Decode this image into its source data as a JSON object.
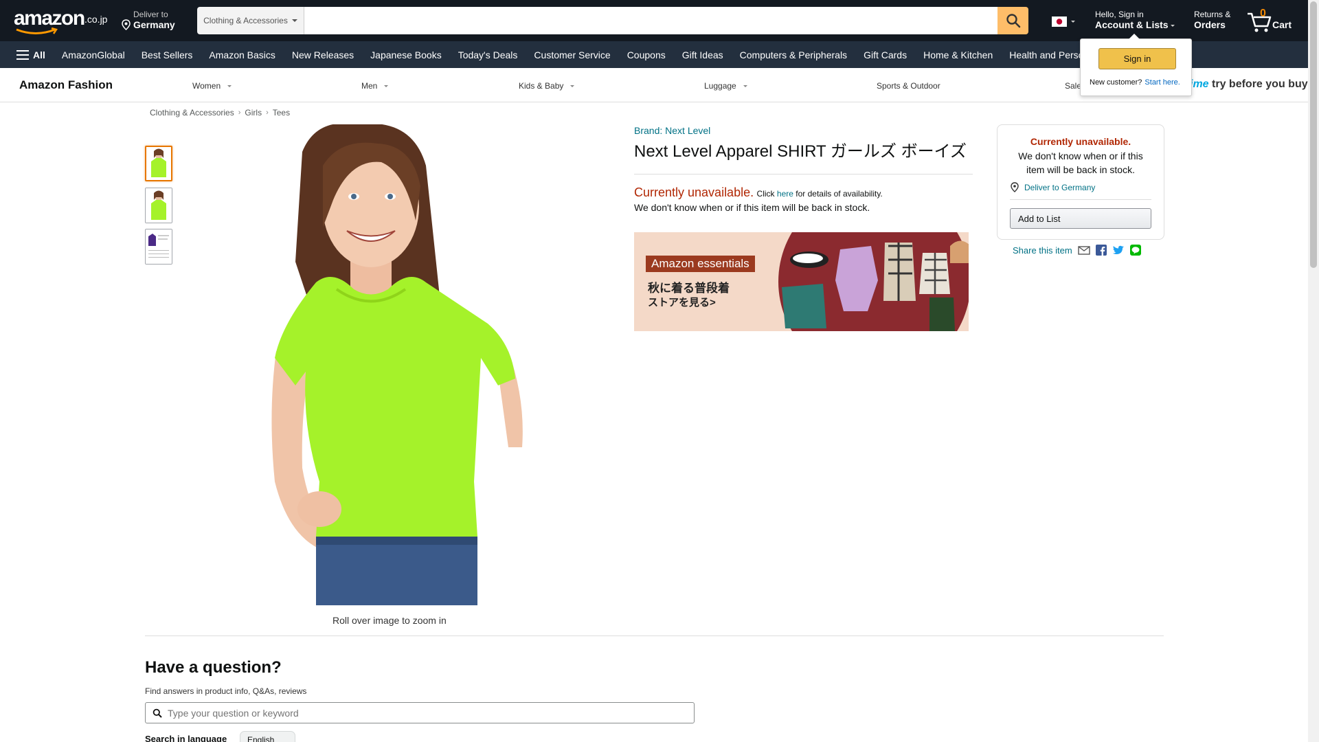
{
  "header": {
    "logo_text": "amazon",
    "logo_suffix": ".co.jp",
    "deliver_line1": "Deliver to",
    "deliver_line2": "Germany",
    "search_category": "Clothing & Accessories",
    "search_placeholder": "",
    "account_line1": "Hello, Sign in",
    "account_line2": "Account & Lists",
    "returns_line1": "Returns &",
    "returns_line2": "Orders",
    "cart_count": "0",
    "cart_label": "Cart"
  },
  "nav": {
    "all_label": "All",
    "links": [
      "AmazonGlobal",
      "Best Sellers",
      "Amazon Basics",
      "New Releases",
      "Japanese Books",
      "Today's Deals",
      "Customer Service",
      "Coupons",
      "Gift Ideas",
      "Computers & Peripherals",
      "Gift Cards",
      "Home & Kitchen",
      "Health and Personal Care"
    ]
  },
  "subnav": {
    "title": "Amazon Fashion",
    "items": [
      "Women",
      "Men",
      "Kids & Baby",
      "Luggage",
      "Sports & Outdoor",
      "Sale"
    ],
    "prime_prefix": "prime",
    "prime_text": "try before you buy"
  },
  "flyout": {
    "signin_label": "Sign in",
    "new_customer": "New customer?",
    "start_here": "Start here."
  },
  "breadcrumb": [
    "Clothing & Accessories",
    "Girls",
    "Tees"
  ],
  "gallery": {
    "zoom_hint": "Roll over image to zoom in"
  },
  "product": {
    "brand": "Brand: Next Level",
    "title": "Next Level Apparel SHIRT ガールズ ボーイズ",
    "unavailable_big": "Currently unavailable.",
    "unavailable_click": "Click",
    "unavailable_here": "here",
    "unavailable_rest": "for details of availability.",
    "unavailable_line2": "We don't know when or if this item will be back in stock."
  },
  "banner": {
    "tag": "Amazon essentials",
    "line1": "秋に着る普段着",
    "line2": "ストアを見る>"
  },
  "buybox": {
    "status": "Currently unavailable.",
    "text": "We don't know when or if this item will be back in stock.",
    "deliver": "Deliver to Germany",
    "add_to_list": "Add to List"
  },
  "share": {
    "label": "Share this item"
  },
  "qa": {
    "title": "Have a question?",
    "subtitle": "Find answers in product info, Q&As, reviews",
    "placeholder": "Type your question or keyword",
    "language_label": "Search in language",
    "language_value": "English"
  },
  "colors": {
    "nav_dark": "#131921",
    "nav_secondary": "#232f3e",
    "accent_orange": "#febd69",
    "unavailable_red": "#b12704",
    "link_teal": "#007185",
    "shirt_green": "#a5f22a"
  }
}
